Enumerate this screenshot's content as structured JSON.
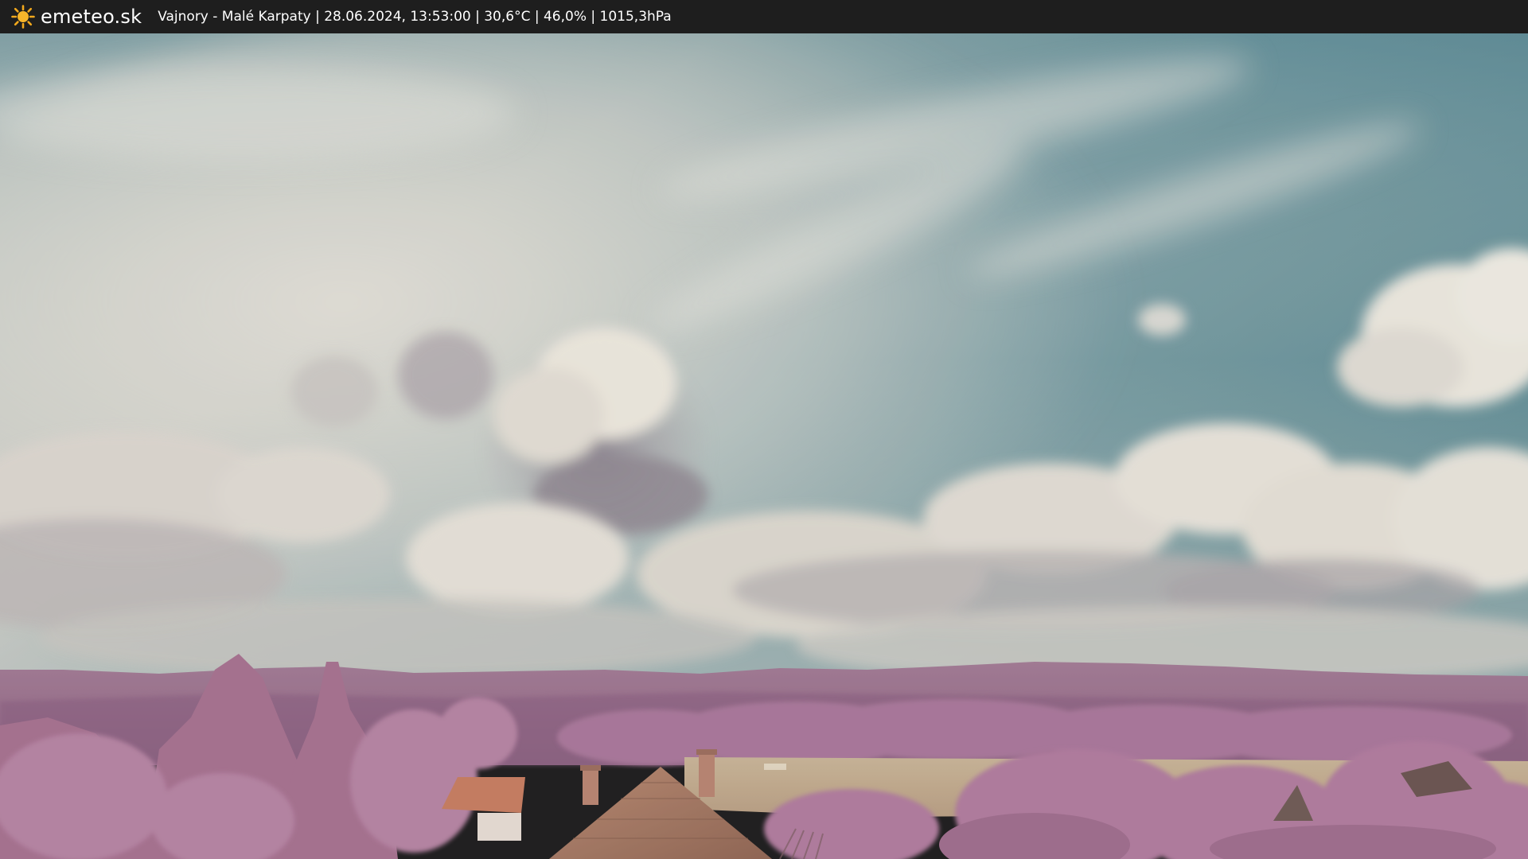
{
  "header": {
    "brand": "emeteo.sk",
    "brand_icon": "sun-icon",
    "caption": "Vajnory - Malé Karpaty | 28.06.2024, 13:53:00 | 30,6°C | 46,0% | 1015,3hPa"
  },
  "scene": {
    "description_icon": "webcam-landscape-image",
    "colors": {
      "sky_top": "#4f8590",
      "sky_haze": "#d4d6cf",
      "clouds": "#e6e3d9",
      "hills": "#9b6e8d",
      "foliage": "#b07c9d",
      "field": "#c3ab8c",
      "roof": "#b7775c"
    }
  }
}
